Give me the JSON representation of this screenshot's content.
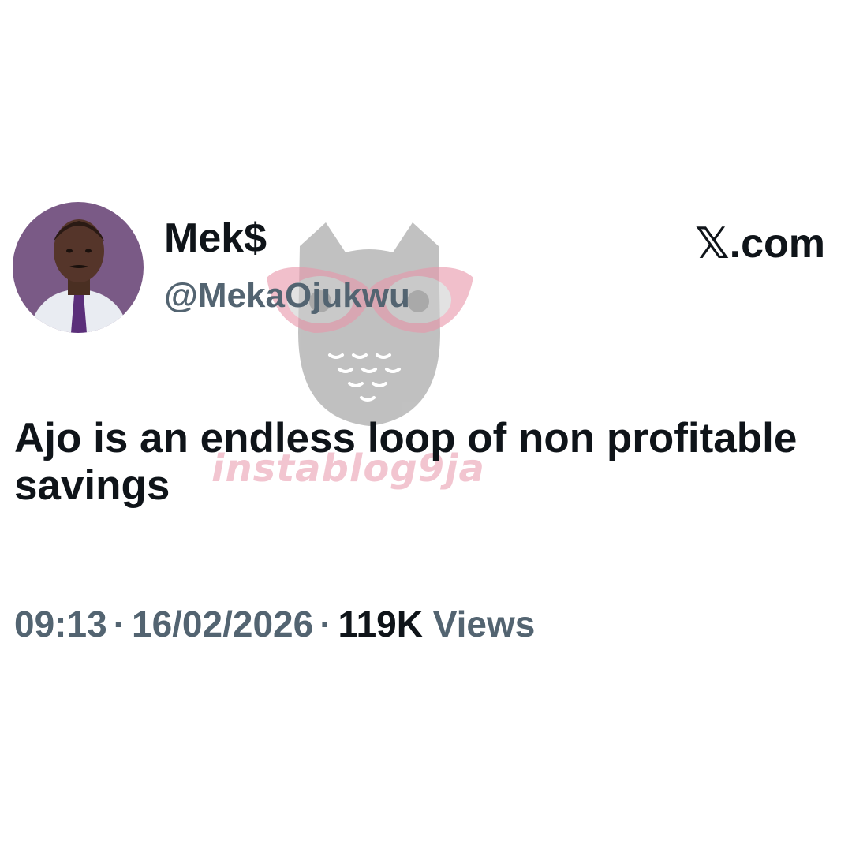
{
  "user": {
    "display_name": "Mek$",
    "handle": "@MekaOjukwu"
  },
  "brand": {
    "logo_glyph": "𝕏",
    "domain": ".com"
  },
  "tweet": {
    "text": "Ajo is an endless loop of non profitable savings"
  },
  "meta": {
    "time": "09:13",
    "separator": "·",
    "date": "16/02/2026",
    "views_count": "119K",
    "views_label": "Views"
  },
  "watermark": {
    "text": "instablog9ja"
  },
  "colors": {
    "text_primary": "#0f1419",
    "text_secondary": "#536471",
    "watermark_pink": "#e896aa",
    "watermark_gray": "#8e8e8e",
    "avatar_background": "#7a5a86"
  }
}
